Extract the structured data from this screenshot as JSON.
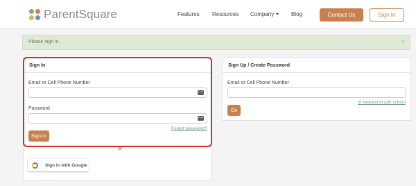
{
  "brand": {
    "name": "ParentSquare",
    "dot_colors": [
      "#7bb26e",
      "#d37a52",
      "#e3b356",
      "#5e95c6"
    ]
  },
  "nav": {
    "features": "Features",
    "resources": "Resources",
    "company": "Company",
    "blog": "Blog",
    "contact_us": "Contact Us",
    "sign_in": "Sign In"
  },
  "alert": {
    "message": "Please sign in.",
    "close": "×"
  },
  "signin": {
    "heading": "Sign In",
    "identifier_label": "Email or Cell Phone Number",
    "identifier_value": "",
    "password_label": "Password",
    "password_value": "",
    "forgot_link": "Forgot password?",
    "submit": "Sign In",
    "or": "or",
    "google": "Sign in with Google"
  },
  "signup": {
    "heading": "Sign Up / Create Password",
    "identifier_label": "Email or Cell Phone Number",
    "identifier_value": "",
    "join_link": "or request to join school",
    "go": "Go"
  },
  "colors": {
    "accent": "#c8814e",
    "alert_bg": "#dfe9d8",
    "highlight": "#d42a26"
  }
}
